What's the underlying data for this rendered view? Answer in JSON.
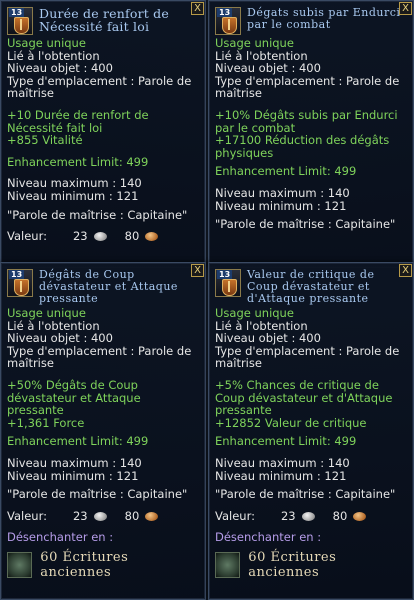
{
  "tooltips": [
    {
      "level": "13",
      "title": "Durée de renfort de Nécessité fait loi",
      "usage": "Usage unique",
      "bind": "Lié à l'obtention",
      "item_level": "Niveau objet : 400",
      "slot": "Type d'emplacement : Parole de maîtrise",
      "effect1": "+10 Durée de renfort de Nécessité fait loi",
      "effect2": "+855 Vitalité",
      "enhancement": "Enhancement Limit: 499",
      "max_level": "Niveau maximum : 140",
      "min_level": "Niveau minimum : 121",
      "class_req": "\"Parole de maîtrise : Capitaine\"",
      "value_label": "Valeur:",
      "silver": "23",
      "copper": "80"
    },
    {
      "level": "13",
      "title": "Dégats subis par Endurci par le combat",
      "usage": "Usage unique",
      "bind": "Lié à l'obtention",
      "item_level": "Niveau objet : 400",
      "slot": "Type d'emplacement : Parole de maîtrise",
      "effect1": "+10% Dégâts subis par Endurci par le combat",
      "effect2": "+17100 Réduction des dégâts physiques",
      "enhancement": "Enhancement Limit: 499",
      "max_level": "Niveau maximum : 140",
      "min_level": "Niveau minimum : 121",
      "class_req": "\"Parole de maîtrise : Capitaine\""
    },
    {
      "level": "13",
      "title": "Dégâts de Coup dévastateur et Attaque pressante",
      "usage": "Usage unique",
      "bind": "Lié à l'obtention",
      "item_level": "Niveau objet : 400",
      "slot": "Type d'emplacement : Parole de maîtrise",
      "effect1": "+50% Dégâts de Coup dévastateur et Attaque pressante",
      "effect2": "+1,361 Force",
      "enhancement": "Enhancement Limit: 499",
      "max_level": "Niveau maximum : 140",
      "min_level": "Niveau minimum : 121",
      "class_req": "\"Parole de maîtrise : Capitaine\"",
      "value_label": "Valeur:",
      "silver": "23",
      "copper": "80",
      "disenchant": "Désenchanter en :",
      "scroll": "60 Écritures anciennes"
    },
    {
      "level": "13",
      "title": "Valeur de critique de Coup dévastateur et d'Attaque pressante",
      "usage": "Usage unique",
      "bind": "Lié à l'obtention",
      "item_level": "Niveau objet : 400",
      "slot": "Type d'emplacement : Parole de maîtrise",
      "effect1": "+5% Chances de critique de Coup dévastateur et d'Attaque pressante",
      "effect2": "+12852 Valeur de critique",
      "enhancement": "Enhancement Limit: 499",
      "max_level": "Niveau maximum : 140",
      "min_level": "Niveau minimum : 121",
      "class_req": "\"Parole de maîtrise : Capitaine\"",
      "value_label": "Valeur:",
      "silver": "23",
      "copper": "80",
      "disenchant": "Désenchanter en :",
      "scroll": "60 Écritures anciennes"
    }
  ],
  "close_label": "X"
}
